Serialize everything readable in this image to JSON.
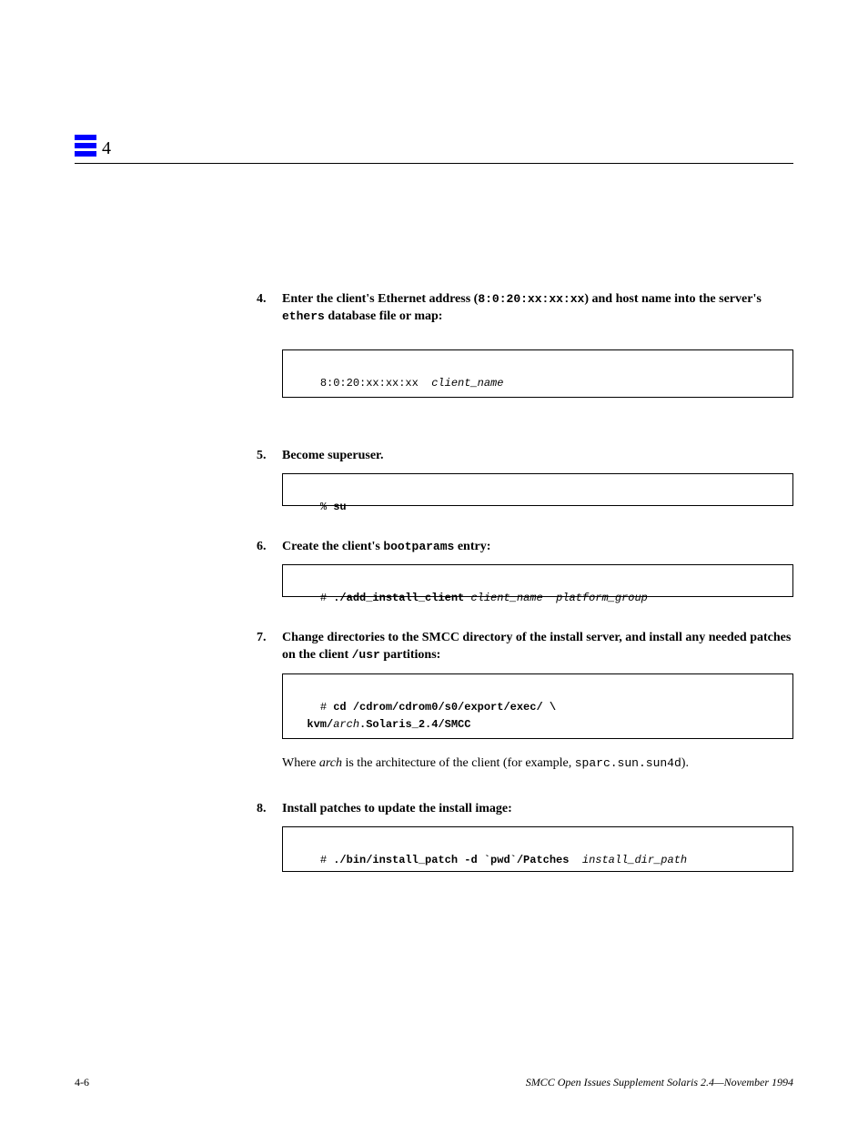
{
  "chapterNum": "4",
  "steps": {
    "s4": {
      "num": "4.",
      "lead_bold": "Enter the client's Ethernet address (",
      "lead_code": "8:0:20:xx:xx:xx",
      "lead_bold2": ") and host name into the server's ",
      "lead_code2": "ethers",
      "lead_bold3": " database file or map:",
      "code": "8:0:20:xx:xx:xx  client_name"
    },
    "s5": {
      "num": "5.",
      "lead": "Become superuser.",
      "code": "% su"
    },
    "s6": {
      "num": "6.",
      "lead_bold": "Create the client's ",
      "lead_code": "bootparams",
      "lead_bold2": " entry:",
      "code": "# ./add_install_client  client_name  platform_group"
    },
    "s7": {
      "num": "7.",
      "lead_bold": "Change directories to the SMCC directory of the install server, and install any needed patches on the client ",
      "lead_code": "/usr",
      "lead_bold2": " partitions:",
      "code": "# cd /cdrom/cdrom0/s0/export/exec/ \\\n  kvm/ arch .Solaris_2.4/SMCC",
      "tail_a": "Where ",
      "tail_arch": "arch",
      "tail_b": " is the architecture of the client (for example, ",
      "tail_code": "sparc.sun.sun4d",
      "tail_c": ")."
    },
    "s8": {
      "num": "8.",
      "lead": "Install patches to update the install image:",
      "code": "# ./bin/install_patch -d `pwd`/Patches   install_dir_path"
    }
  },
  "footer": {
    "pageNum": "4-6",
    "bookTitle": "SMCC Open Issues Supplement Solaris 2.4—November 1994"
  }
}
